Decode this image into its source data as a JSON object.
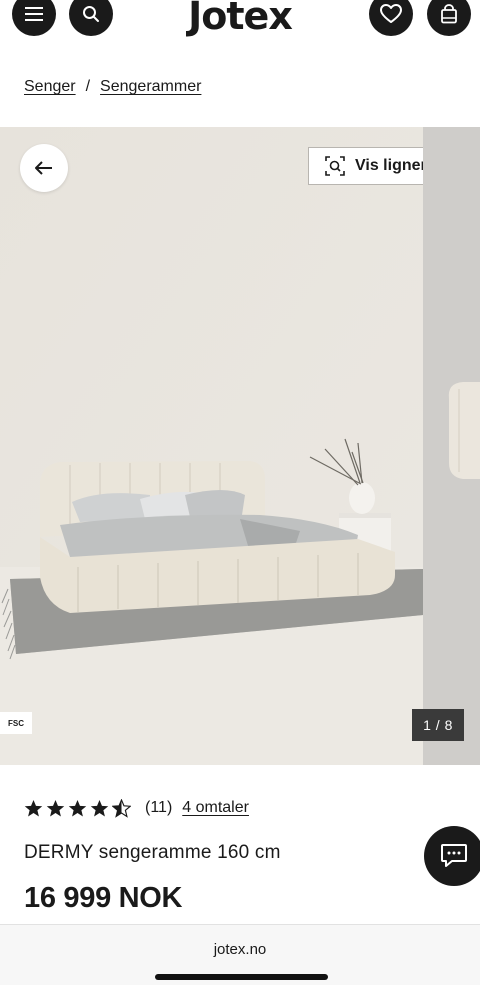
{
  "header": {
    "logo": "Jotex",
    "menu_icon": "menu-icon",
    "search_icon": "search-icon",
    "wishlist_icon": "heart-icon",
    "cart_icon": "bag-icon"
  },
  "breadcrumb": {
    "items": [
      "Senger",
      "Sengerammer"
    ],
    "separator": "/"
  },
  "gallery": {
    "back_icon": "arrow-left-icon",
    "similar_label": "Vis lignende",
    "similar_icon": "visual-search-icon",
    "badge": "FSC",
    "counter": "1 / 8"
  },
  "product": {
    "rating": 4.5,
    "rating_max": 5,
    "review_count": "(11)",
    "reviews_link": "4 omtaler",
    "title": "DERMY sengeramme 160 cm",
    "price": "16 999 NOK"
  },
  "chat": {
    "icon": "chat-icon"
  },
  "browser": {
    "url": "jotex.no"
  },
  "colors": {
    "dark": "#1a1a1a",
    "background": "#ffffff",
    "photo_wall": "#e9e6df"
  }
}
